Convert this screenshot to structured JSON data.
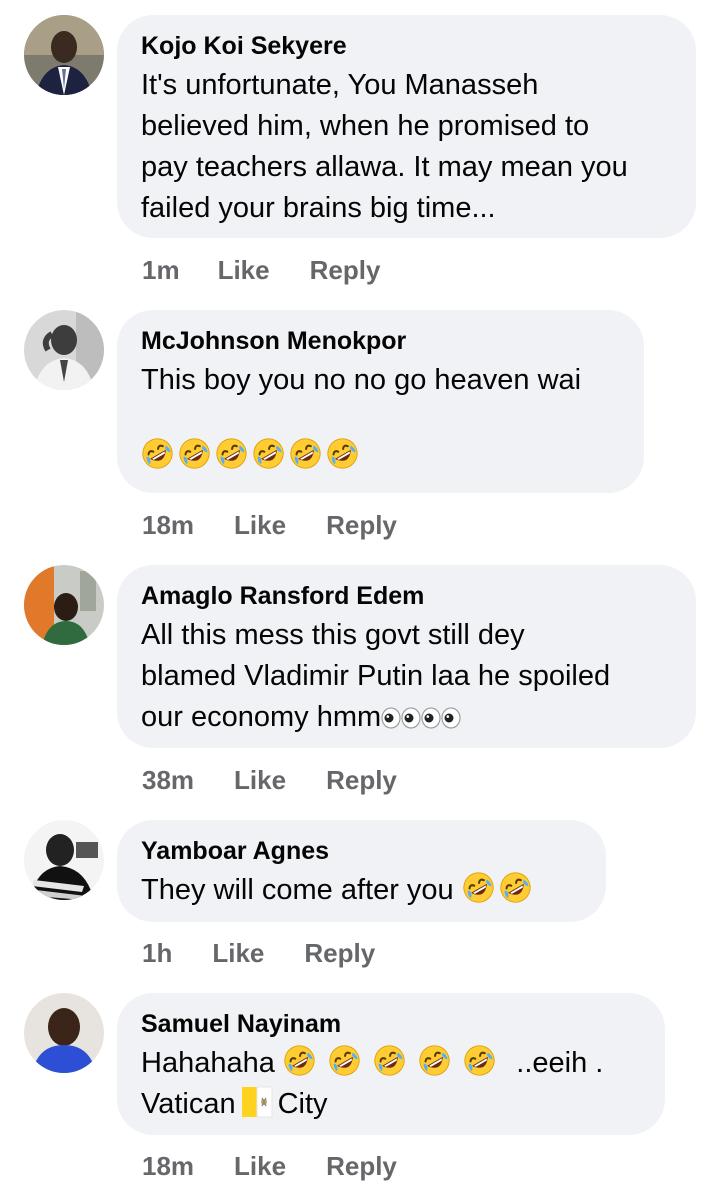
{
  "comments": [
    {
      "author": "Kojo Koi Sekyere",
      "lines": [
        "It's unfortunate, You Manasseh",
        "believed him, when he promised to",
        "pay teachers allawa. It may mean you",
        "failed your brains big time..."
      ],
      "time": "1m",
      "like": "Like",
      "reply": "Reply"
    },
    {
      "author": "McJohnson Menokpor",
      "text": "This boy you no no go heaven wai",
      "emojis": [
        "rolling-on-floor-laughing",
        "rolling-on-floor-laughing",
        "rolling-on-floor-laughing",
        "rolling-on-floor-laughing",
        "rolling-on-floor-laughing",
        "rolling-on-floor-laughing"
      ],
      "time": "18m",
      "like": "Like",
      "reply": "Reply"
    },
    {
      "author": "Amaglo Ransford Edem",
      "lines": [
        "All this mess this govt still dey",
        "blamed Vladimir Putin laa he spoiled"
      ],
      "last_line": "our economy hmm",
      "emojis": [
        "eyes",
        "eyes",
        "eyes",
        "eyes"
      ],
      "time": "38m",
      "like": "Like",
      "reply": "Reply"
    },
    {
      "author": "Yamboar Agnes",
      "text": "They will come after you",
      "emojis": [
        "rolling-on-floor-laughing",
        "rolling-on-floor-laughing"
      ],
      "time": "1h",
      "like": "Like",
      "reply": "Reply"
    },
    {
      "author": "Samuel Nayinam",
      "line1_start": "Hahahaha",
      "line1_end": "..eeih .",
      "line2_start": "Vatican",
      "line2_end": "City",
      "emojis": [
        "rolling-on-floor-laughing",
        "rolling-on-floor-laughing",
        "rolling-on-floor-laughing",
        "rolling-on-floor-laughing",
        "rolling-on-floor-laughing"
      ],
      "flag": "vatican-flag",
      "time": "18m",
      "like": "Like",
      "reply": "Reply"
    }
  ],
  "colors": {
    "bubble": "#f0f2f5",
    "meta": "#65676b",
    "text": "#050505"
  }
}
